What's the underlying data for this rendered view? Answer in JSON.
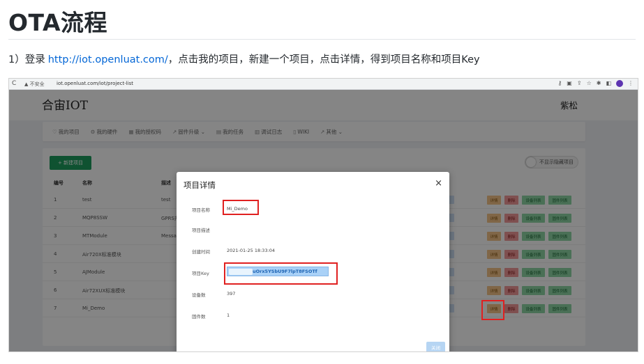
{
  "doc": {
    "title": "OTA流程",
    "step": {
      "prefix": "1）登录",
      "link": "http://iot.openluat.com/",
      "rest": "，点击我的项目，新建一个项目，点击详情，得到项目名称和项目Key"
    }
  },
  "browser": {
    "reload_icon": "reload-icon",
    "security_label": "▲ 不安全",
    "url": "iot.openluat.com/iot/project-list"
  },
  "app": {
    "brand": "合宙IOT",
    "user": "紫松",
    "nav": [
      {
        "icon": "lightbulb-icon",
        "glyph": "♡",
        "label": "我的项目"
      },
      {
        "icon": "gear-icon",
        "glyph": "⚙",
        "label": "我的硬件"
      },
      {
        "icon": "grid-icon",
        "glyph": "▦",
        "label": "我的授权码"
      },
      {
        "icon": "trend-icon",
        "glyph": "↗",
        "label": "固件升级 ⌄"
      },
      {
        "icon": "doc-icon",
        "glyph": "▤",
        "label": "我的任务"
      },
      {
        "icon": "table-icon",
        "glyph": "▥",
        "label": "调试日志"
      },
      {
        "icon": "book-icon",
        "glyph": "▯",
        "label": "WIKI"
      },
      {
        "icon": "trend-icon",
        "glyph": "↗",
        "label": "其他 ⌄"
      }
    ],
    "new_project": "+ 新建项目",
    "hide_toggle": "不显示隐藏项目",
    "columns": [
      "编号",
      "名称",
      "描述"
    ],
    "rows": [
      {
        "id": "1",
        "name": "test",
        "desc": "test"
      },
      {
        "id": "2",
        "name": "MQP8SSW",
        "desc": "GPRS升"
      },
      {
        "id": "3",
        "name": "MTModule",
        "desc": "Messag"
      },
      {
        "id": "4",
        "name": "Air720X标准模块",
        "desc": ""
      },
      {
        "id": "5",
        "name": "AJModule",
        "desc": ""
      },
      {
        "id": "6",
        "name": "Air72XUX标准模块",
        "desc": ""
      },
      {
        "id": "7",
        "name": "Mi_Demo",
        "desc": ""
      }
    ],
    "actions": {
      "detail": "详情",
      "delete": "删除",
      "device": "设备列表",
      "firmware": "固件列表"
    }
  },
  "dialog": {
    "title": "项目详情",
    "close_icon": "×",
    "fields": [
      {
        "label": "项目名称",
        "value": "Mi_Demo"
      },
      {
        "label": "项目描述",
        "value": ""
      },
      {
        "label": "创建时间",
        "value": "2021-01-25 18:33:04"
      },
      {
        "label": "项目Key",
        "value": "uOrx5YSbU9F7lpT8FSOTf"
      },
      {
        "label": "设备数",
        "value": "397"
      },
      {
        "label": "固件数",
        "value": "1"
      }
    ],
    "close_button": "关闭"
  },
  "colors": {
    "highlight": "#e02020",
    "link": "#0366d6",
    "green": "#1d9e5f"
  }
}
